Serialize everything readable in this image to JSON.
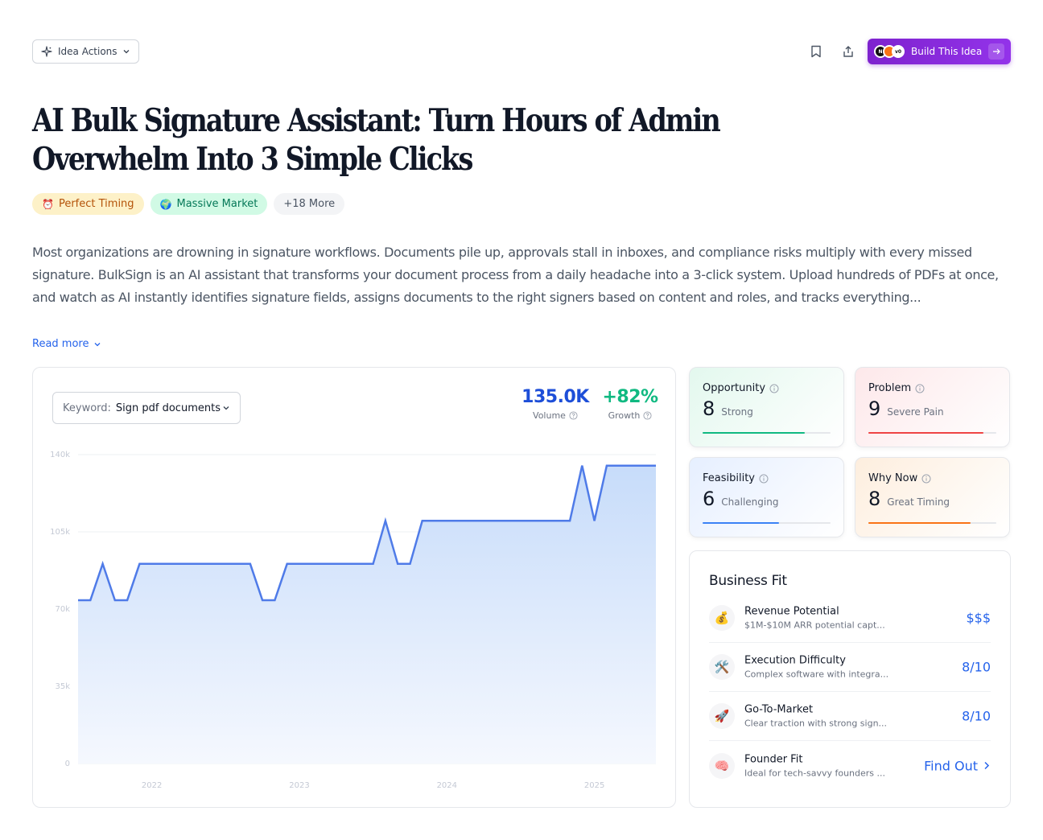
{
  "toolbar": {
    "idea_actions_label": "Idea Actions",
    "build_label": "Build This Idea",
    "logo_1": "N",
    "logo_2": "",
    "logo_3": "v0"
  },
  "title": "AI Bulk Signature Assistant: Turn Hours of Admin Overwhelm Into 3 Simple Clicks",
  "tags": [
    {
      "emoji": "⏰",
      "label": "Perfect Timing"
    },
    {
      "emoji": "🌍",
      "label": "Massive Market"
    },
    {
      "label": "+18 More"
    }
  ],
  "description": "Most organizations are drowning in signature workflows. Documents pile up, approvals stall in inboxes, and compliance risks multiply with every missed signature. BulkSign is an AI assistant that transforms your document process from a daily headache into a 3-click system. Upload hundreds of PDFs at once, and watch as AI instantly identifies signature fields, assigns documents to the right signers based on content and roles, and tracks everything...",
  "read_more": "Read more",
  "keyword": {
    "label": "Keyword:",
    "value": "Sign pdf documents"
  },
  "metrics": {
    "volume_value": "135.0K",
    "volume_label": "Volume",
    "growth_value": "+82%",
    "growth_label": "Growth"
  },
  "chart_data": {
    "type": "area",
    "ylim": [
      0,
      140000
    ],
    "yticks": [
      {
        "value": 0,
        "label": "0"
      },
      {
        "value": 35000,
        "label": "35k"
      },
      {
        "value": 70000,
        "label": "70k"
      },
      {
        "value": 105000,
        "label": "105k"
      },
      {
        "value": 140000,
        "label": "140k"
      }
    ],
    "xticks": [
      "2022",
      "2023",
      "2024",
      "2025"
    ],
    "x": [
      "2021-07",
      "2021-08",
      "2021-09",
      "2021-10",
      "2021-11",
      "2021-12",
      "2022-01",
      "2022-02",
      "2022-03",
      "2022-04",
      "2022-05",
      "2022-06",
      "2022-07",
      "2022-08",
      "2022-09",
      "2022-10",
      "2022-11",
      "2022-12",
      "2023-01",
      "2023-02",
      "2023-03",
      "2023-04",
      "2023-05",
      "2023-06",
      "2023-07",
      "2023-08",
      "2023-09",
      "2023-10",
      "2023-11",
      "2023-12",
      "2024-01",
      "2024-02",
      "2024-03",
      "2024-04",
      "2024-05",
      "2024-06",
      "2024-07",
      "2024-08",
      "2024-09",
      "2024-10",
      "2024-11",
      "2024-12",
      "2025-01",
      "2025-02",
      "2025-03",
      "2025-04",
      "2025-05",
      "2025-06"
    ],
    "values": [
      74000,
      74000,
      90500,
      74000,
      74000,
      90500,
      90500,
      90500,
      90500,
      90500,
      90500,
      90500,
      90500,
      90500,
      90500,
      74000,
      74000,
      90500,
      90500,
      90500,
      90500,
      90500,
      90500,
      90500,
      90500,
      110000,
      90500,
      90500,
      110000,
      110000,
      110000,
      110000,
      110000,
      110000,
      110000,
      110000,
      110000,
      110000,
      110000,
      110000,
      110000,
      135000,
      110000,
      135000,
      135000,
      135000,
      135000,
      135000
    ],
    "color": "#4f7be8"
  },
  "scores": {
    "opportunity": {
      "title": "Opportunity",
      "value": "8",
      "word": "Strong",
      "fraction": 0.8,
      "color": "#10b981"
    },
    "problem": {
      "title": "Problem",
      "value": "9",
      "word": "Severe Pain",
      "fraction": 0.9,
      "color": "#ef4444"
    },
    "feasibility": {
      "title": "Feasibility",
      "value": "6",
      "word": "Challenging",
      "fraction": 0.6,
      "color": "#3b82f6"
    },
    "why_now": {
      "title": "Why Now",
      "value": "8",
      "word": "Great Timing",
      "fraction": 0.8,
      "color": "#f97316"
    }
  },
  "business_fit": {
    "title": "Business Fit",
    "rows": [
      {
        "icon": "💰",
        "name": "Revenue Potential",
        "sub": "$1M-$10M ARR potential capt...",
        "value": "$$$"
      },
      {
        "icon": "🛠️",
        "name": "Execution Difficulty",
        "sub": "Complex software with integra...",
        "value": "8/10"
      },
      {
        "icon": "🚀",
        "name": "Go-To-Market",
        "sub": "Clear traction with strong sign...",
        "value": "8/10"
      },
      {
        "icon": "🧠",
        "name": "Founder Fit",
        "sub": "Ideal for tech-savvy founders ...",
        "value": "Find Out"
      }
    ]
  }
}
